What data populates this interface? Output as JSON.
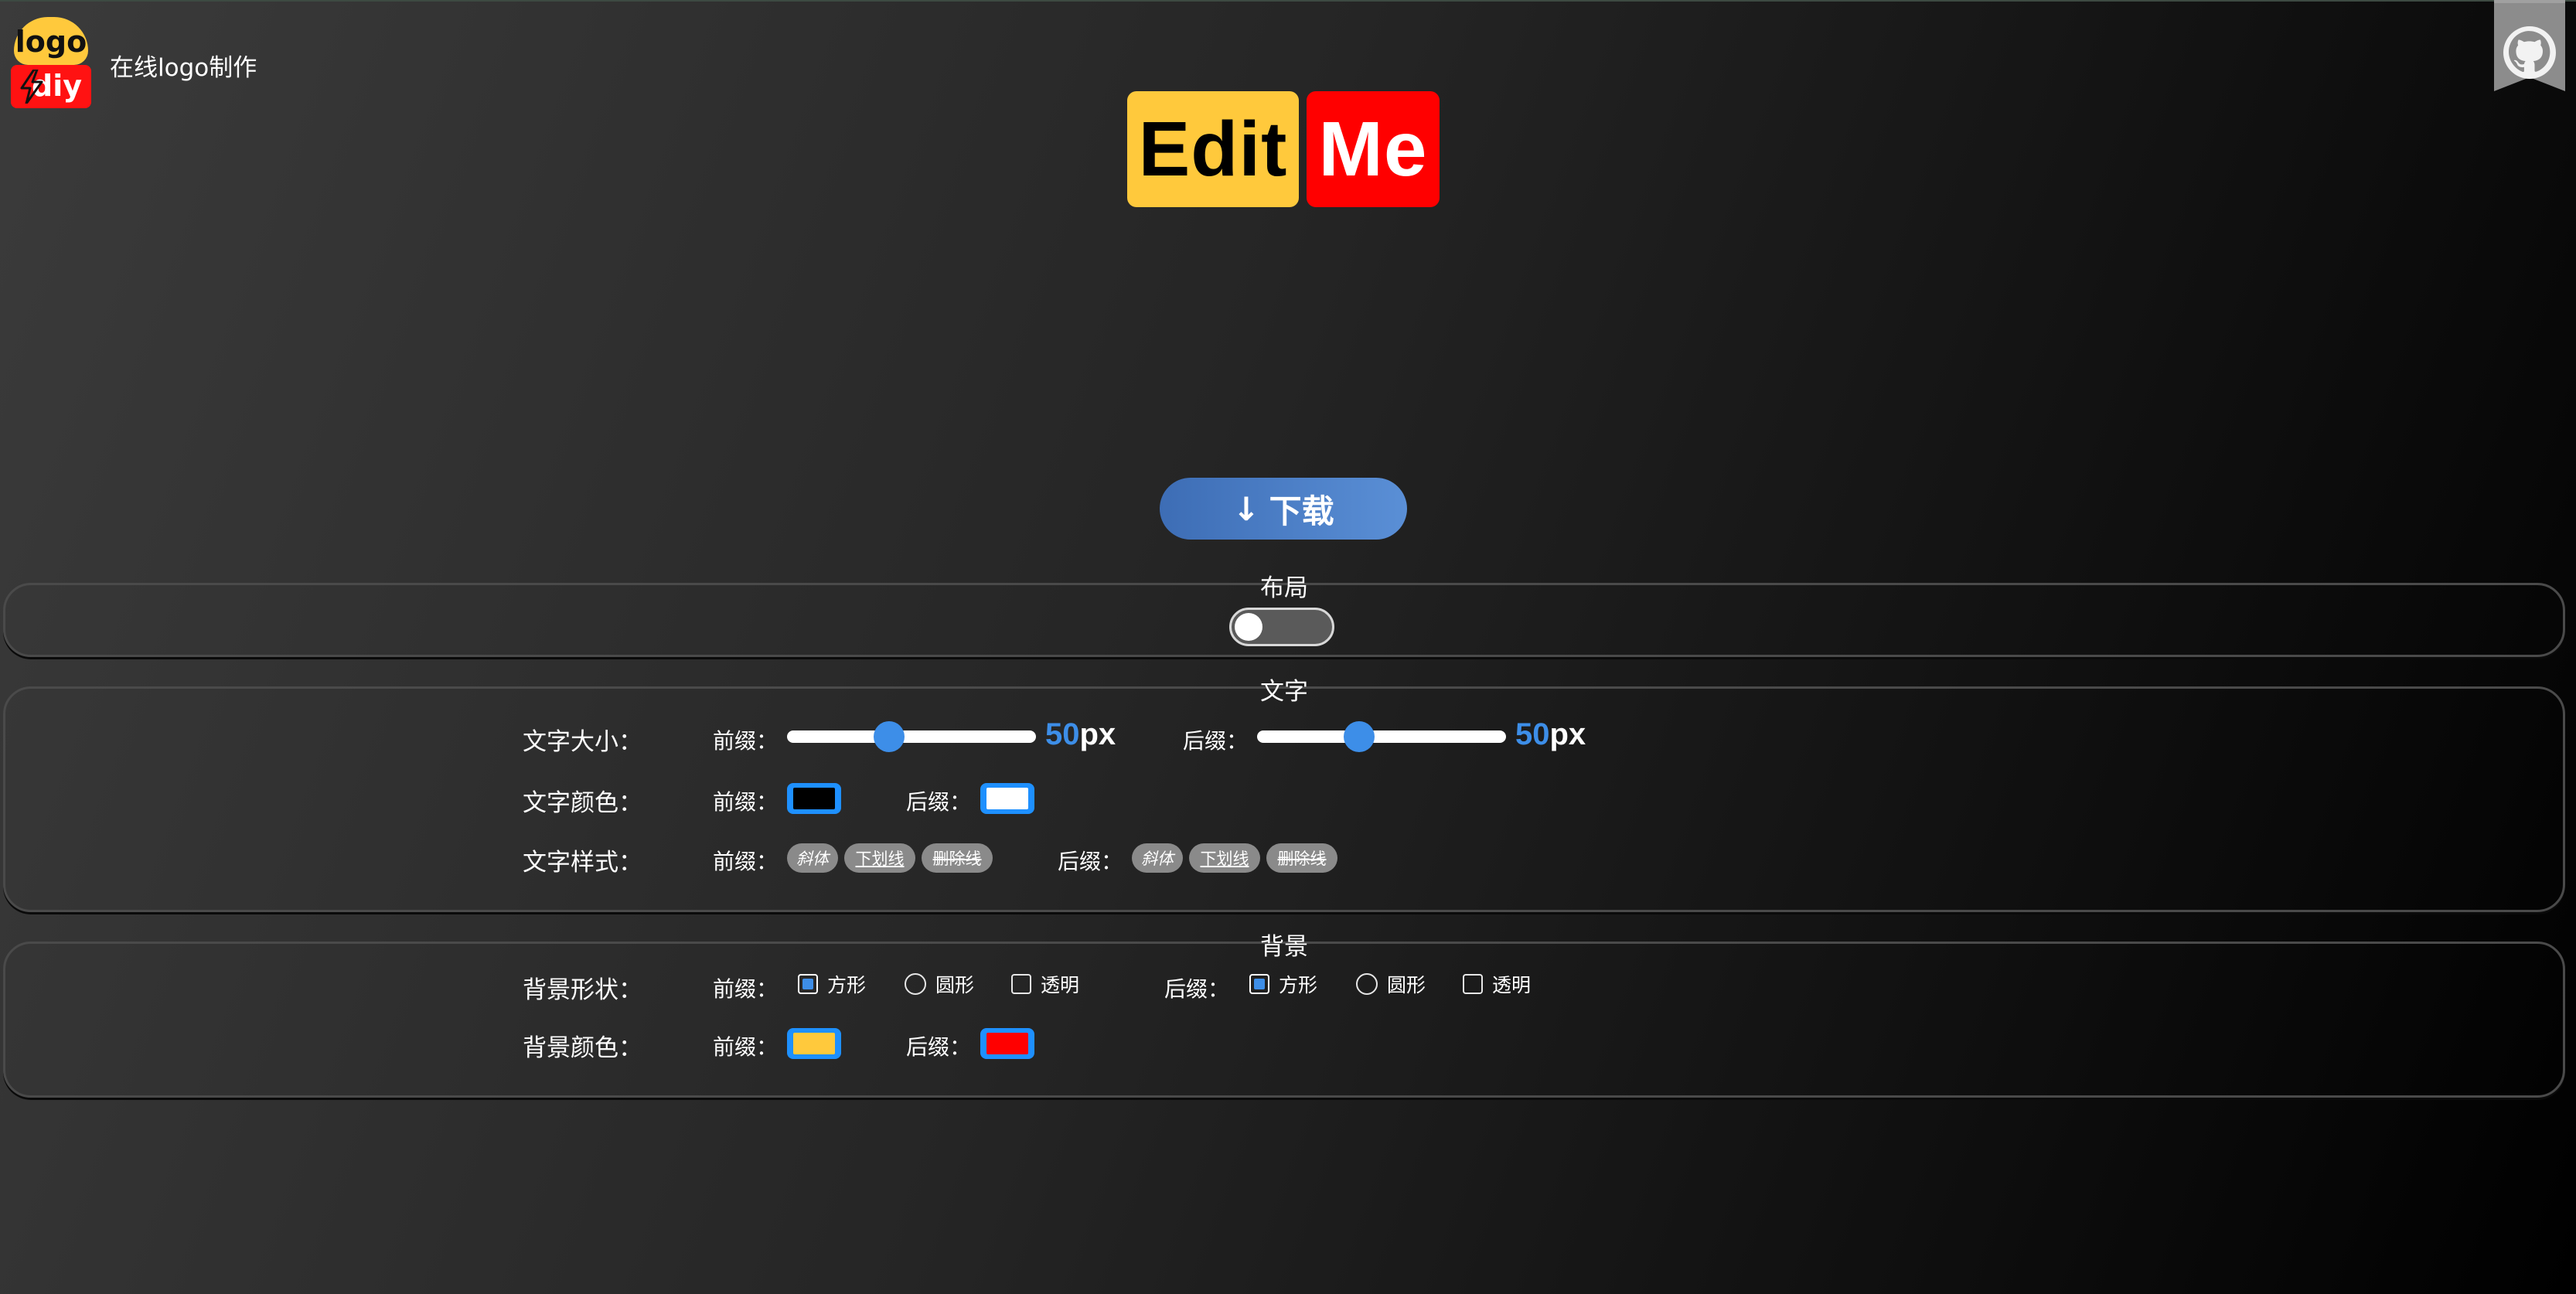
{
  "header": {
    "logo_top_text": "logo",
    "logo_bottom_text": "diy",
    "site_title": "在线logo制作"
  },
  "preview": {
    "prefix_text": "Edit",
    "suffix_text": "Me",
    "prefix_bg": "#ffc93c",
    "suffix_bg": "#ff0000",
    "prefix_color": "#000000",
    "suffix_color": "#ffffff"
  },
  "download": {
    "icon": "↓",
    "label": "下载"
  },
  "layout_section": {
    "legend": "布局",
    "toggle_on": false
  },
  "text_section": {
    "legend": "文字",
    "size_label": "文字大小：",
    "color_label": "文字颜色：",
    "style_label": "文字样式：",
    "prefix_label": "前缀：",
    "suffix_label": "后缀：",
    "prefix_size": "50",
    "suffix_size": "50",
    "size_unit": "px",
    "slider_fraction": 0.4,
    "prefix_color": "#000000",
    "suffix_color": "#ffffff",
    "style_buttons": [
      "斜体",
      "下划线",
      "删除线"
    ]
  },
  "bg_section": {
    "legend": "背景",
    "shape_label": "背景形状：",
    "color_label": "背景颜色：",
    "prefix_label": "前缀：",
    "suffix_label": "后缀：",
    "shape_square": "方形",
    "shape_circle": "圆形",
    "shape_transparent": "透明",
    "prefix_shape": "方形",
    "suffix_shape": "方形",
    "prefix_color": "#ffc93c",
    "suffix_color": "#ff0000"
  },
  "colors": {
    "accent": "#3d8ee8",
    "swatch_border": "#1e90ff",
    "github_corner": "#8c8c8c"
  }
}
